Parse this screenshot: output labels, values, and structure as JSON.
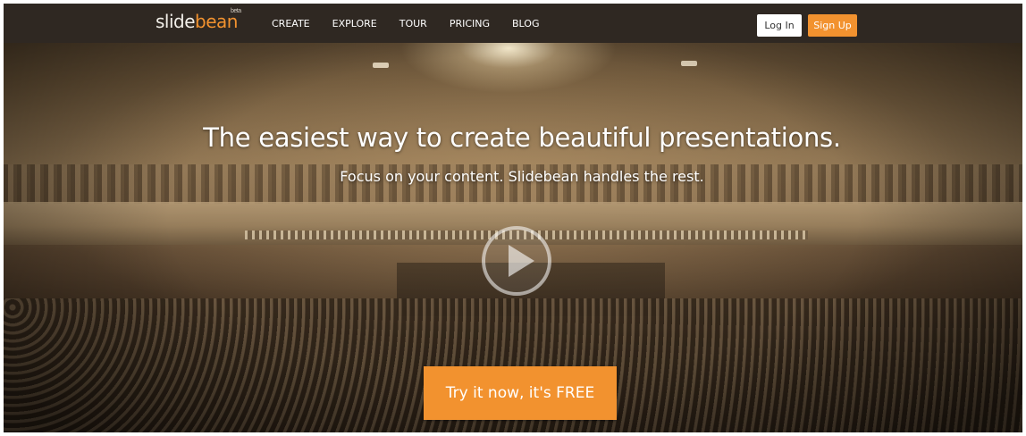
{
  "brand": {
    "logo_light": "slide",
    "logo_accent": "bean",
    "badge": "beta",
    "accent_color": "#f2922f"
  },
  "nav": {
    "items": [
      {
        "label": "CREATE"
      },
      {
        "label": "EXPLORE"
      },
      {
        "label": "TOUR"
      },
      {
        "label": "PRICING"
      },
      {
        "label": "BLOG"
      }
    ],
    "login_label": "Log In",
    "signup_label": "Sign Up"
  },
  "hero": {
    "headline": "The easiest way to create beautiful presentations.",
    "subheadline": "Focus on your content. Slidebean handles the rest.",
    "play_icon": "play-icon",
    "cta_label": "Try it now, it's FREE"
  }
}
